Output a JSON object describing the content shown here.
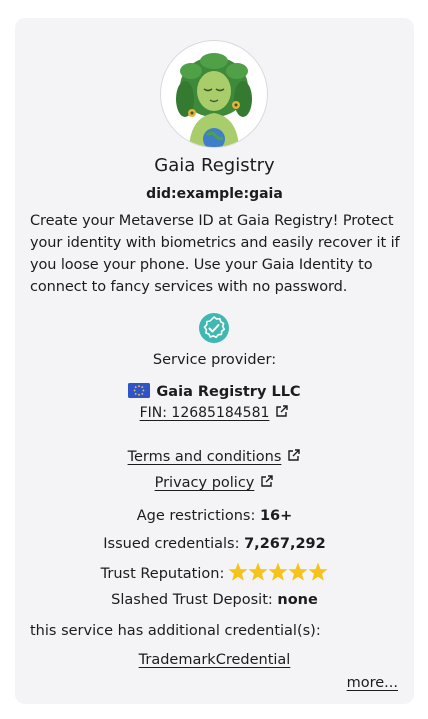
{
  "profile": {
    "name": "Gaia Registry",
    "did": "did:example:gaia",
    "description": "Create your Metaverse ID at Gaia Registry! Protect your identity with biometrics and easily recover it if you loose your phone. Use your Gaia Identity to connect to fancy services with no password."
  },
  "service_provider": {
    "label": "Service provider:",
    "name": "Gaia Registry LLC",
    "fin": "FIN: 12685184581"
  },
  "links": {
    "terms": "Terms and conditions",
    "privacy": "Privacy policy"
  },
  "stats": {
    "age_label": "Age restrictions:",
    "age_value": "16+",
    "issued_label": "Issued credentials:",
    "issued_value": "7,267,292",
    "trust_label": "Trust Reputation:",
    "trust_stars": 5,
    "slashed_label": "Slashed Trust Deposit:",
    "slashed_value": "none"
  },
  "credentials": {
    "intro": "this service has additional credential(s):",
    "items": [
      "TrademarkCredential"
    ],
    "more": "more..."
  },
  "colors": {
    "verified": "#3fb8b1",
    "star": "#f6c21c",
    "flag": "#2f54c9"
  }
}
